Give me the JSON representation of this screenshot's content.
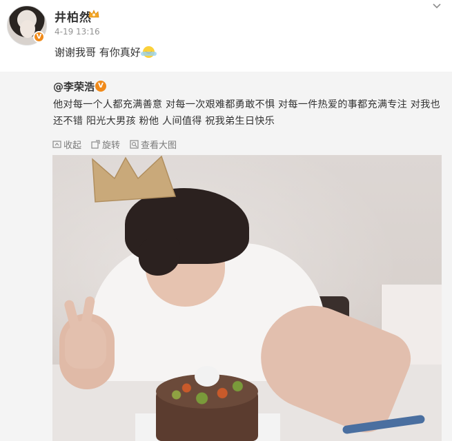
{
  "post": {
    "username": "井柏然",
    "time": "4-19 13:16",
    "text": "谢谢我哥 有你真好"
  },
  "repost": {
    "at_user": "@李荣浩",
    "text": "他对每一个人都充满善意 对每一次艰难都勇敢不惧 对每一件热爱的事都充满专注 对我也还不错 阳光大男孩 粉他 人间值得 祝我弟生日快乐"
  },
  "toolbar": {
    "collapse_label": "收起",
    "rotate_label": "旋转",
    "view_large_label": "查看大图"
  },
  "icons": {
    "verified": "verified-badge-icon",
    "crown": "crown-badge-icon",
    "chevron": "chevron-down-icon",
    "emoji": "touched-emoji-icon"
  },
  "colors": {
    "verified_orange": "#f08a1a",
    "repost_bg": "#f4f4f4",
    "secondary_text": "#939393"
  }
}
